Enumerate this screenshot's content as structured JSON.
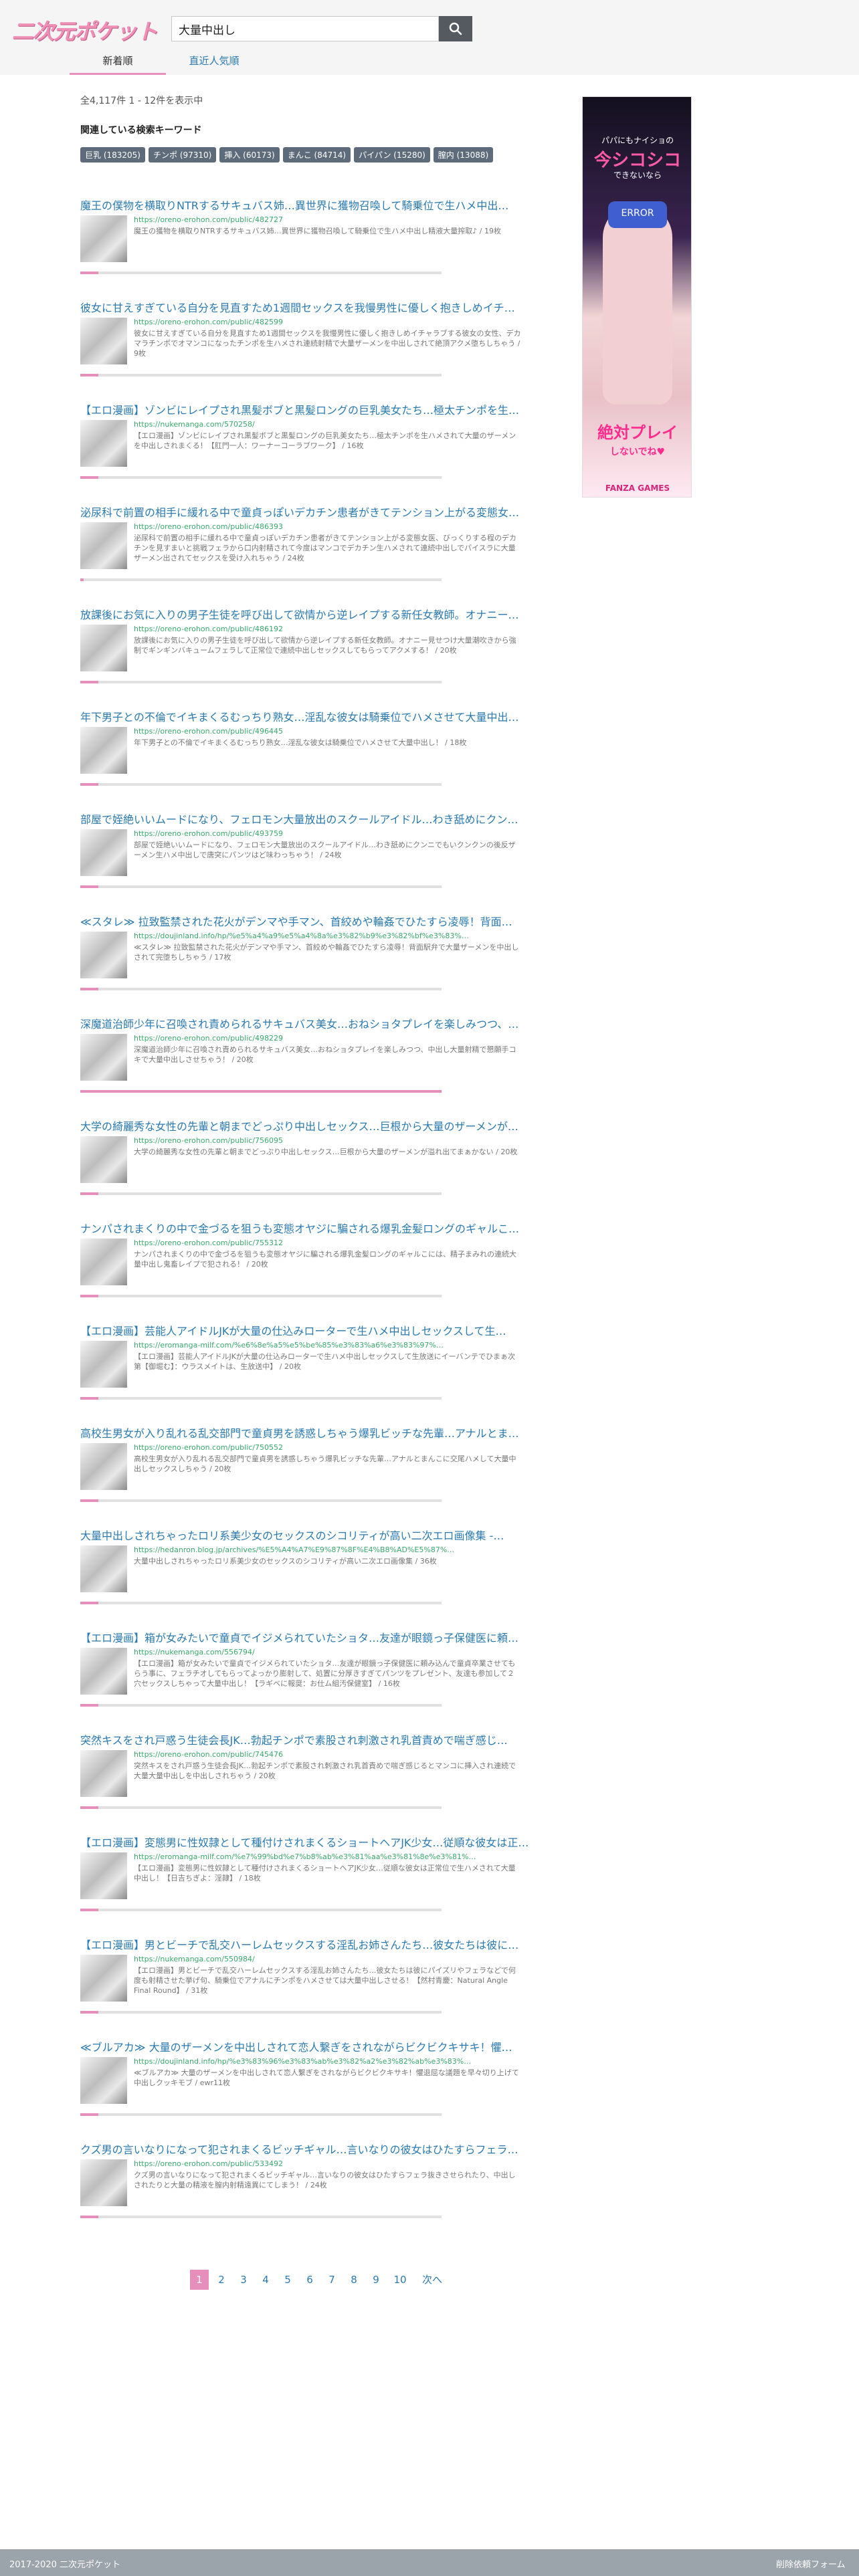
{
  "logo": "二次元ポケット",
  "search": {
    "value": "大量中出し"
  },
  "tabs": [
    {
      "label": "新着順",
      "active": true
    },
    {
      "label": "直近人気順",
      "active": false
    }
  ],
  "result_count": "全4,117件 1 - 12件を表示中",
  "related_keywords_title": "関連している検索キーワード",
  "related_keywords": [
    "巨乳 (183205)",
    "チンポ (97310)",
    "挿入 (60173)",
    "まんこ (84714)",
    "パイパン (15280)",
    "膣内 (13088)"
  ],
  "accent_colors": {
    "link": "#2a7ab0",
    "url": "#3aa86b",
    "pink": "#e68fbd"
  },
  "entries": [
    {
      "title": "魔王の僕物を横取りNTRするサキュバス姉…異世界に獲物召喚して騎乗位で生ハメ中出…",
      "url": "https://oreno-erohon.com/public/482727",
      "desc": "魔王の獲物を横取りNTRするサキュバス姉…異世界に獲物召喚して騎乗位で生ハメ中出し精液大量搾取♪ / 19枚",
      "progress": 0.05
    },
    {
      "title": "彼女に甘えすぎている自分を見直すため1週間セックスを我慢男性に優しく抱きしめイチ…",
      "url": "https://oreno-erohon.com/public/482599",
      "desc": "彼女に甘えすぎている自分を見直すため1週間セックスを我慢男性に優しく抱きしめイチャラブする彼女の女性、デカマラチンポでオマンコになったチンポを生ハメされ連続射精で大量ザーメンを中出しされて絶頂アクメ堕ちしちゃう / 9枚",
      "progress": 0.05
    },
    {
      "title": "【エロ漫画】ゾンビにレイプされ黒髪ボブと黒髪ロングの巨乳美女たち…極太チンポを生…",
      "url": "https://nukemanga.com/570258/",
      "desc": "【エロ漫画】ゾンビにレイプされ黒髪ボブと黒髪ロングの巨乳美女たち…極太チンポを生ハメされて大量のザーメンを中出しされまくる！【肛門一人：ワーナーコーラブワーク】 / 16枚",
      "progress": 0.05
    },
    {
      "title": "泌尿科で前置の相手に緩れる中で童貞っぽいデカチン患者がきてテンション上がる変態女…",
      "url": "https://oreno-erohon.com/public/486393",
      "desc": "泌尿科で前置の相手に緩れる中で童貞っぽいデカチン患者がきてテンション上がる変態女医、びっくりする程のデカチンを見すまいと挑戦フェラから口内射精されて今度はマンコでデカチン生ハメされて連続中出しでパイスラに大量ザーメン出されてセックスを受け入れちゃう / 24枚",
      "progress": 0.01
    },
    {
      "title": "放課後にお気に入りの男子生徒を呼び出して欲情から逆レイプする新任女教師。オナニー…",
      "url": "https://oreno-erohon.com/public/486192",
      "desc": "放課後にお気に入りの男子生徒を呼び出して欲情から逆レイプする新任女教師。オナニー見せつけ大量潮吹きから強制でギンギンバキュームフェラして正常位で連続中出しセックスしてもらってアクメする！ / 20枚",
      "progress": 0.05
    },
    {
      "title": "年下男子との不倫でイキまくるむっちり熟女…淫乱な彼女は騎乗位でハメさせて大量中出…",
      "url": "https://oreno-erohon.com/public/496445",
      "desc": "年下男子との不倫でイキまくるむっちり熟女…淫乱な彼女は騎乗位でハメさせて大量中出し！ / 18枚",
      "progress": 0.05
    },
    {
      "title": "部屋で姪絶いいムードになり、フェロモン大量放出のスクールアイドル…わき舐めにクン…",
      "url": "https://oreno-erohon.com/public/493759",
      "desc": "部屋で姪絶いいムードになり、フェロモン大量放出のスクールアイドル…わき舐めにクンニでもいクンクンの後反ザーメン生ハメ中出しで唐突にパンツはど味わっちゃう！ / 24枚",
      "progress": 0.05
    },
    {
      "title": "≪スタレ≫ 拉致監禁された花火がデンマや手マン、首絞めや輪姦でひたすら凌辱！背面…",
      "url": "https://doujinland.info/hp/%e5%a4%a9%e5%a4%8a%e3%82%b9%e3%82%bf%e3%83%…",
      "desc": "≪スタレ≫ 拉致監禁された花火がデンマや手マン、首絞めや輪姦でひたすら凌辱！背面駅弁で大量ザーメンを中出しされて完堕ちしちゃう / 17枚",
      "progress": 0.05
    },
    {
      "title": "深魔道治師少年に召喚され責められるサキュバス美女…おねショタプレイを楽しみつつ、…",
      "url": "https://oreno-erohon.com/public/498229",
      "desc": "深魔道治師少年に召喚され責められるサキュバス美女…おねショタプレイを楽しみつつ、中出し大量射精で懇願手コキで大量中出しさせちゃう！ / 20枚",
      "progress": 1
    },
    {
      "title": "大学の綺麗秀な女性の先輩と朝までどっぷり中出しセックス…巨根から大量のザーメンが…",
      "url": "https://oreno-erohon.com/public/756095",
      "desc": "大学の綺麗秀な女性の先輩と朝までどっぷり中出しセックス…巨根から大量のザーメンが溢れ出てまぁかない / 20枚",
      "progress": 0.05
    },
    {
      "title": "ナンパされまくりの中で金づるを狙うも変態オヤジに騙される爆乳金髪ロングのギャルこ…",
      "url": "https://oreno-erohon.com/public/755312",
      "desc": "ナンパされまくりの中で金づるを狙うも変態オヤジに騙される爆乳金髪ロングのギャルこには、精子まみれの連続大量中出し鬼畜レイプで犯される！ / 20枚",
      "progress": 0.05
    },
    {
      "title": "【エロ漫画】芸能人アイドルJKが大量の仕込みローターで生ハメ中出しセックスして生…",
      "url": "https://eromanga-milf.com/%e6%8e%a5%e5%be%85%e3%83%a6%e3%83%97%…",
      "desc": "【エロ漫画】芸能人アイドルJKが大量の仕込みローターで生ハメ中出しセックスして生放送にイーバンテでひまぁ次第【御堀む】：ウラスメイトは、生放送中】 / 20枚",
      "progress": 0.05
    },
    {
      "title": "高校生男女が入り乱れる乱交部門で童貞男を誘惑しちゃう爆乳ビッチな先輩…アナルとま…",
      "url": "https://oreno-erohon.com/public/750552",
      "desc": "高校生男女が入り乱れる乱交部門で童貞男を誘惑しちゃう爆乳ビッチな先輩…アナルとまんこに交尾ハメして大量中出しセックスしちゃう / 20枚",
      "progress": 0.05
    },
    {
      "title": "大量中出しされちゃったロリ系美少女のセックスのシコリティが高い二次エロ画像集 -…",
      "url": "https://hedanron.blog.jp/archives/%E5%A4%A7%E9%87%8F%E4%B8%AD%E5%87%…",
      "desc": "大量中出しされちゃったロリ系美少女のセックスのシコリティが高い二次エロ画像集 / 36枚",
      "progress": 0.05
    },
    {
      "title": "【エロ漫画】箱が女みたいで童貞でイジメられていたショタ…友達が眼鏡っ子保健医に頼…",
      "url": "https://nukemanga.com/556794/",
      "desc": "【エロ漫画】箱が女みたいで童貞でイジメられていたショタ…友達が眼鏡っ子保健医に頼み込んで童貞卒業させてもらう事に、フェラチオしてもらってよっかり膨射して、処置に分厚きすぎてパンツをプレゼント、友達も参加して２穴セックスしちゃって大量中出し！【ラギベに報奨：お仕ム組汚保健室】 / 16枚",
      "progress": 0.05
    },
    {
      "title": "突然キスをされ戸惑う生徒会長JK…勃起チンポで素股され刺激され乳首責めで喘ぎ感じ…",
      "url": "https://oreno-erohon.com/public/745476",
      "desc": "突然キスをされ戸惑う生徒会長JK…勃起チンポで素股され刺激され乳首責めで喘ぎ感じるとマンコに挿入され連続で大量大量中出しを中出しされちゃう / 20枚",
      "progress": 0.05
    },
    {
      "title": "【エロ漫画】変態男に性奴隷として種付けされまくるショートヘアJK少女…従順な彼女は正…",
      "url": "https://eromanga-milf.com/%e7%99%bd%e7%b8%ab%e3%81%aa%e3%81%8e%e3%81%…",
      "desc": "【エロ漫画】変態男に性奴隷として種付けされまくるショートヘアJK少女…従順な彼女は正常位で生ハメされて大量中出し！【日吉ちぎよ：淫隷】 / 18枚",
      "progress": 0.05
    },
    {
      "title": "【エロ漫画】男とビーチで乱交ハーレムセックスする淫乱お姉さんたち…彼女たちは彼に…",
      "url": "https://nukemanga.com/550984/",
      "desc": "【エロ漫画】男とビーチで乱交ハーレムセックスする淫乱お姉さんたち…彼女たちは彼にパイズリやフェラなどで何度も射精させた挙げ句、騎乗位でアナルにチンポをハメさせては大量中出しさせる！【然村青慶：Natural Angle Final Round】 / 31枚",
      "progress": 0.05
    },
    {
      "title": "≪ブルアカ≫ 大量のザーメンを中出しされて恋人繋ぎをされながらビクビクキサキ！懼…",
      "url": "https://doujinland.info/hp/%e3%83%96%e3%83%ab%e3%82%a2%e3%82%ab%e3%83%…",
      "desc": "≪ブルアカ≫ 大量のザーメンを中出しされて恋人繋ぎをされながらビクビクキサキ！懼退屈な議題を早々切り上げて中出しクッキモブ / ewr11枚",
      "progress": 0.05
    },
    {
      "title": "クズ男の言いなりになって犯されまくるビッチギャル…言いなりの彼女はひたすらフェラ…",
      "url": "https://oreno-erohon.com/public/533492",
      "desc": "クズ男の言いなりになって犯されまくるビッチギャル…言いなりの彼女はひたすらフェラ抜きさせられたり、中出しされたりと大量の精液を膣内射精遠異にてしまう！ / 24枚",
      "progress": 0.05
    }
  ],
  "pagination": {
    "pages": [
      "1",
      "2",
      "3",
      "4",
      "5",
      "6",
      "7",
      "8",
      "9",
      "10"
    ],
    "current": "1",
    "next": "次へ"
  },
  "ad": {
    "line1": "パパにもナイショの",
    "line2": "今シコシコ",
    "line3": "できないなら",
    "visor": "ERROR",
    "line4": "絶対プレイ",
    "line5": "しないでね♥",
    "brand": "FANZA GAMES"
  },
  "footer": {
    "copyright": "2017-2020 二次元ポケット",
    "contact": "削除依頼フォーム"
  }
}
